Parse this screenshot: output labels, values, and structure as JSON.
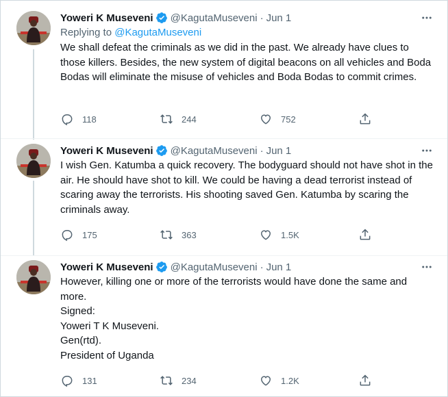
{
  "author": {
    "display_name": "Yoweri K Museveni",
    "handle": "@KagutaMuseveni"
  },
  "icons": {
    "verified": "verified-badge-icon",
    "more": "more-options-icon",
    "reply": "reply-icon",
    "retweet": "retweet-icon",
    "like": "like-icon",
    "share": "share-icon"
  },
  "colors": {
    "verified": "#1d9bf0",
    "link": "#1d9bf0",
    "secondary_text": "#536471",
    "border": "#cfd9de"
  },
  "tweets": [
    {
      "dot": "·",
      "date": "Jun 1",
      "replying_label": "Replying to",
      "replying_to": "@KagutaMuseveni",
      "text": "We shall defeat the criminals as we did in the past. We already have clues to those killers. Besides, the new system of digital beacons on all vehicles and Boda Bodas will eliminate the misuse of vehicles and Boda Bodas to commit crimes.",
      "replies": "118",
      "retweets": "244",
      "likes": "752"
    },
    {
      "dot": "·",
      "date": "Jun 1",
      "text": "I wish Gen. Katumba a quick recovery. The bodyguard should not have shot in the air. He should have shot to kill. We could be having a dead terrorist instead of scaring away the terrorists. His shooting saved Gen. Katumba by scaring the criminals away.",
      "replies": "175",
      "retweets": "363",
      "likes": "1.5K"
    },
    {
      "dot": "·",
      "date": "Jun 1",
      "text": "However, killing one or more of the terrorists would have done the same and more.\nSigned:\nYoweri T K Museveni.\nGen(rtd).\nPresident of Uganda",
      "replies": "131",
      "retweets": "234",
      "likes": "1.2K"
    }
  ]
}
